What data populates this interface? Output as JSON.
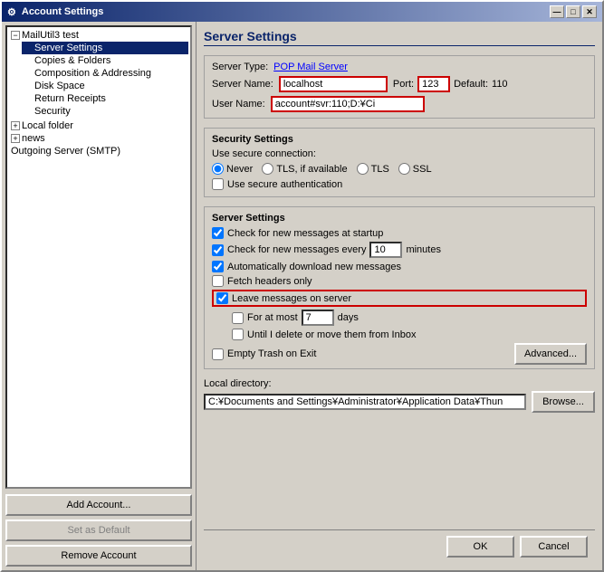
{
  "window": {
    "title": "Account Settings",
    "close_label": "✕",
    "maximize_label": "□",
    "minimize_label": "—"
  },
  "sidebar": {
    "tree": [
      {
        "id": "mailutil3",
        "label": "MailUtil3 test",
        "level": 0,
        "expander": "−",
        "selected": false
      },
      {
        "id": "server-settings",
        "label": "Server Settings",
        "level": 1,
        "selected": true
      },
      {
        "id": "copies-folders",
        "label": "Copies & Folders",
        "level": 1,
        "selected": false
      },
      {
        "id": "composition",
        "label": "Composition & Addressing",
        "level": 1,
        "selected": false
      },
      {
        "id": "disk-space",
        "label": "Disk Space",
        "level": 1,
        "selected": false
      },
      {
        "id": "return-receipts",
        "label": "Return Receipts",
        "level": 1,
        "selected": false
      },
      {
        "id": "security",
        "label": "Security",
        "level": 1,
        "selected": false
      },
      {
        "id": "local-folder",
        "label": "Local folder",
        "level": 0,
        "expander": "+",
        "selected": false
      },
      {
        "id": "news",
        "label": "news",
        "level": 0,
        "expander": "+",
        "selected": false
      },
      {
        "id": "outgoing-smtp",
        "label": "Outgoing Server (SMTP)",
        "level": 0,
        "selected": false
      }
    ],
    "buttons": {
      "add_account": "Add Account...",
      "set_default": "Set as Default",
      "remove_account": "Remove Account"
    }
  },
  "main": {
    "title": "Server Settings",
    "server_type_label": "Server Type:",
    "server_type_value": "POP Mail Server",
    "server_name_label": "Server Name:",
    "server_name_value": "localhost",
    "port_label": "Port:",
    "port_value": "123",
    "default_label": "Default:",
    "default_value": "110",
    "user_name_label": "User Name:",
    "user_name_value": "account#svr:110;D:¥Ci",
    "security_section": {
      "title": "Security Settings",
      "use_secure_label": "Use secure connection:",
      "radio_options": [
        {
          "id": "never",
          "label": "Never",
          "checked": true
        },
        {
          "id": "tls-available",
          "label": "TLS, if available",
          "checked": false
        },
        {
          "id": "tls",
          "label": "TLS",
          "checked": false
        },
        {
          "id": "ssl",
          "label": "SSL",
          "checked": false
        }
      ],
      "auth_label": "Use secure authentication",
      "auth_checked": false
    },
    "server_settings_section": {
      "title": "Server Settings",
      "checkboxes": [
        {
          "id": "check-startup",
          "label": "Check for new messages at startup",
          "checked": true
        },
        {
          "id": "check-every",
          "label": "Check for new messages every",
          "checked": true,
          "has_input": true,
          "input_value": "10",
          "input_suffix": "minutes"
        },
        {
          "id": "auto-download",
          "label": "Automatically download new messages",
          "checked": true
        },
        {
          "id": "fetch-headers",
          "label": "Fetch headers only",
          "checked": false
        },
        {
          "id": "leave-messages",
          "label": "Leave messages on server",
          "checked": true,
          "highlighted": true
        },
        {
          "id": "for-at-most",
          "label": "For at most",
          "checked": false,
          "indented": true,
          "has_input": true,
          "input_value": "7",
          "input_suffix": "days"
        },
        {
          "id": "until-delete",
          "label": "Until I delete or move them from Inbox",
          "checked": false,
          "indented": true
        },
        {
          "id": "empty-trash",
          "label": "Empty Trash on Exit",
          "checked": false
        }
      ],
      "advanced_btn": "Advanced..."
    },
    "local_dir": {
      "label": "Local directory:",
      "value": "C:¥Documents and Settings¥Administrator¥Application Data¥Thun",
      "browse_btn": "Browse..."
    },
    "bottom_buttons": {
      "ok": "OK",
      "cancel": "Cancel"
    }
  }
}
